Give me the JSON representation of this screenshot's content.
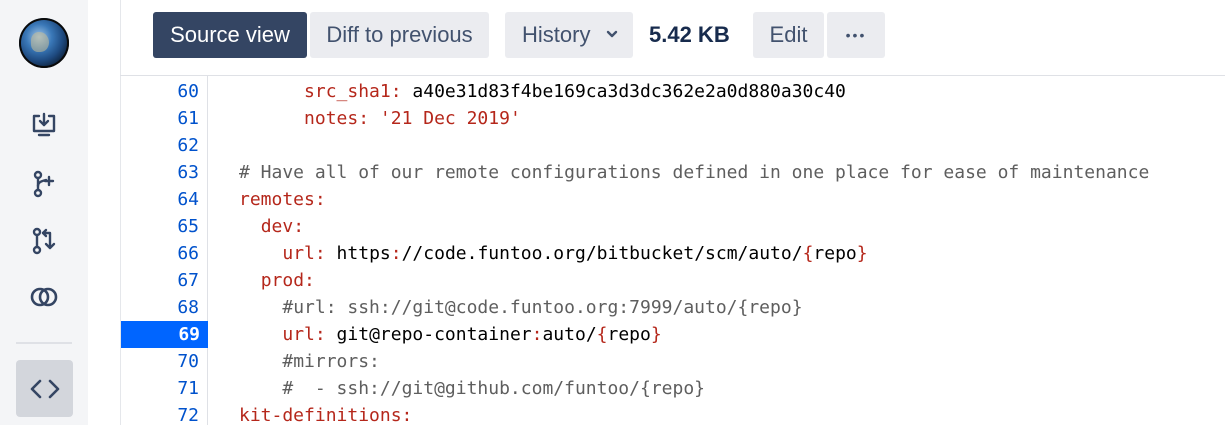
{
  "toolbar": {
    "source_view": "Source view",
    "diff_to_previous": "Diff to previous",
    "history": "History",
    "file_size": "5.42 KB",
    "edit": "Edit",
    "more": "•••"
  },
  "sidebar": {
    "items": [
      {
        "icon": "download-icon"
      },
      {
        "icon": "branch-icon"
      },
      {
        "icon": "pull-request-icon"
      },
      {
        "icon": "compare-icon"
      },
      {
        "icon": "code-icon",
        "active": true
      }
    ]
  },
  "code": {
    "active_line": 69,
    "lines": [
      {
        "n": "60",
        "indent": "      ",
        "key": "src_sha1:",
        "val": " a40e31d83f4be169ca3d3dc362e2a0d880a30c40"
      },
      {
        "n": "61",
        "indent": "      ",
        "key": "notes:",
        "str": " '21 Dec 2019'"
      },
      {
        "n": "62"
      },
      {
        "n": "63",
        "comment": "# Have all of our remote configurations defined in one place for ease of maintenance"
      },
      {
        "n": "64",
        "key": "remotes:"
      },
      {
        "n": "65",
        "indent": "  ",
        "key": "dev:"
      },
      {
        "n": "66",
        "indent": "    ",
        "key": "url:",
        "url_a": " https",
        "url_b": "//code.funtoo.org/bitbucket/scm/auto/",
        "url_c": "repo"
      },
      {
        "n": "67",
        "indent": "  ",
        "key": "prod:"
      },
      {
        "n": "68",
        "indent": "    ",
        "comment": "#url: ssh://git@code.funtoo.org:7999/auto/{repo}"
      },
      {
        "n": "69",
        "indent": "    ",
        "key": "url:",
        "url_a": " git@repo-container",
        "url_b": "auto/",
        "url_c": "repo"
      },
      {
        "n": "70",
        "indent": "    ",
        "comment": "#mirrors:"
      },
      {
        "n": "71",
        "indent": "    ",
        "comment": "#  - ssh://git@github.com/funtoo/{repo}"
      },
      {
        "n": "72",
        "key": "kit-definitions:"
      }
    ]
  }
}
